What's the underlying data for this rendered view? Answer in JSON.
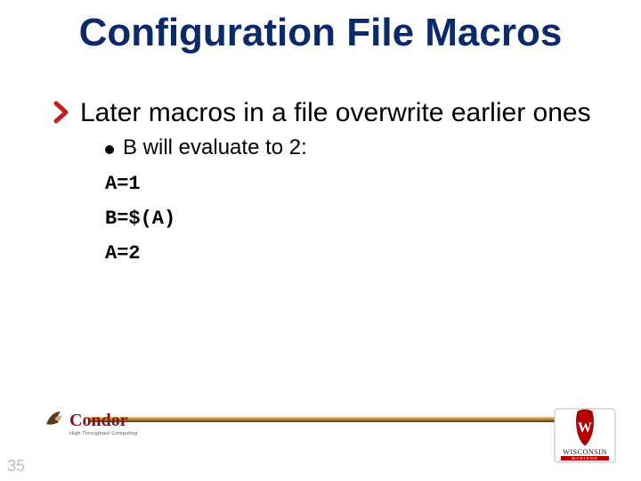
{
  "title": "Configuration File Macros",
  "main_bullet": "Later macros in a file overwrite earlier ones",
  "sub_bullet": "B will evaluate to 2:",
  "code": {
    "line1": "A=1",
    "line2": "B=$(A)",
    "line3": "A=2"
  },
  "slide_number": "35",
  "logos": {
    "condor_text": "Condor",
    "condor_tag": "High Throughput Computing",
    "wisc_text": "WISCONSIN",
    "wisc_sub": "MADISON"
  },
  "colors": {
    "title_blue": "#0b2a6b",
    "chevron_red": "#c21f1f",
    "wisc_red": "#b70101"
  }
}
